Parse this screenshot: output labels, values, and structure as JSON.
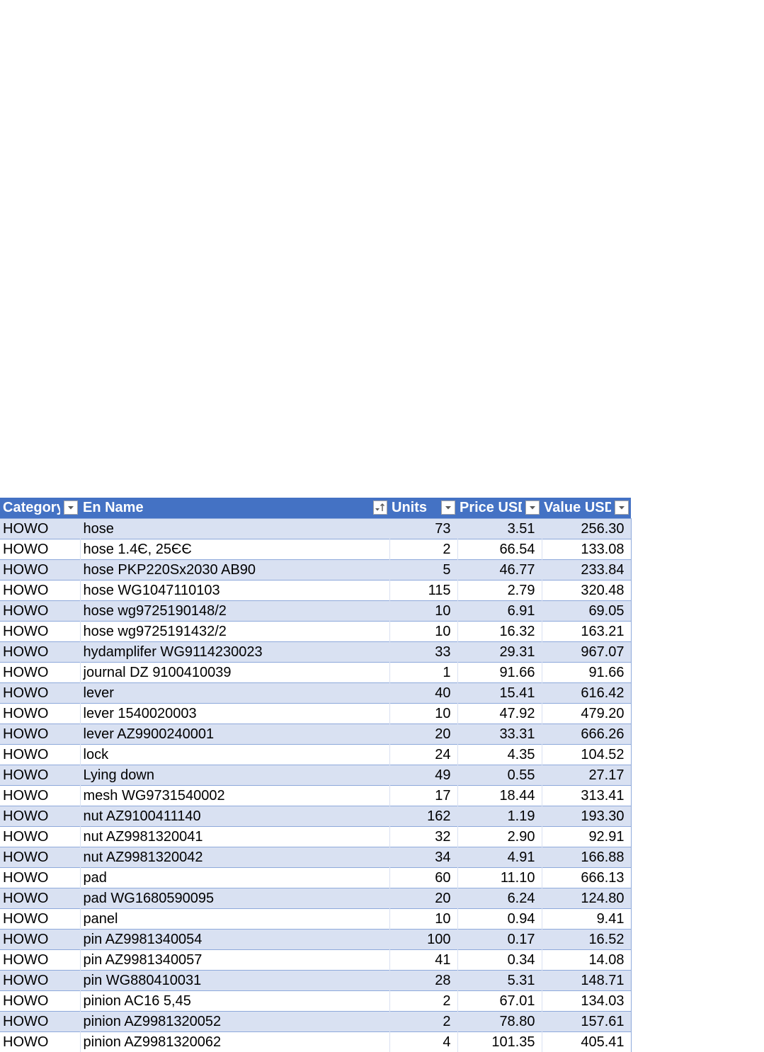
{
  "table": {
    "headers": {
      "category": "Category",
      "name": "En Name",
      "units": "Units",
      "price": "Price USD",
      "value": "Value USD"
    },
    "rows": [
      {
        "category": "HOWO",
        "name": "hose",
        "units": "73",
        "price": "3.51",
        "value": "256.30"
      },
      {
        "category": "HOWO",
        "name": "hose 1.4Є, 25ЄЄ",
        "units": "2",
        "price": "66.54",
        "value": "133.08"
      },
      {
        "category": "HOWO",
        "name": "hose PKP220Sx2030 AB90",
        "units": "5",
        "price": "46.77",
        "value": "233.84"
      },
      {
        "category": "HOWO",
        "name": "hose WG1047110103",
        "units": "115",
        "price": "2.79",
        "value": "320.48"
      },
      {
        "category": "HOWO",
        "name": "hose wg9725190148/2",
        "units": "10",
        "price": "6.91",
        "value": "69.05"
      },
      {
        "category": "HOWO",
        "name": "hose wg9725191432/2",
        "units": "10",
        "price": "16.32",
        "value": "163.21"
      },
      {
        "category": "HOWO",
        "name": "hydamplifer WG9114230023",
        "units": "33",
        "price": "29.31",
        "value": "967.07"
      },
      {
        "category": "HOWO",
        "name": "journal DZ 9100410039",
        "units": "1",
        "price": "91.66",
        "value": "91.66"
      },
      {
        "category": "HOWO",
        "name": "lever",
        "units": "40",
        "price": "15.41",
        "value": "616.42"
      },
      {
        "category": "HOWO",
        "name": "lever  1540020003",
        "units": "10",
        "price": "47.92",
        "value": "479.20"
      },
      {
        "category": "HOWO",
        "name": "lever AZ9900240001",
        "units": "20",
        "price": "33.31",
        "value": "666.26"
      },
      {
        "category": "HOWO",
        "name": "lock",
        "units": "24",
        "price": "4.35",
        "value": "104.52"
      },
      {
        "category": "HOWO",
        "name": "Lying down",
        "units": "49",
        "price": "0.55",
        "value": "27.17"
      },
      {
        "category": "HOWO",
        "name": "mesh WG9731540002",
        "units": "17",
        "price": "18.44",
        "value": "313.41"
      },
      {
        "category": "HOWO",
        "name": "nut AZ9100411140",
        "units": "162",
        "price": "1.19",
        "value": "193.30"
      },
      {
        "category": "HOWO",
        "name": "nut AZ9981320041",
        "units": "32",
        "price": "2.90",
        "value": "92.91"
      },
      {
        "category": "HOWO",
        "name": "nut AZ9981320042",
        "units": "34",
        "price": "4.91",
        "value": "166.88"
      },
      {
        "category": "HOWO",
        "name": "pad",
        "units": "60",
        "price": "11.10",
        "value": "666.13"
      },
      {
        "category": "HOWO",
        "name": "pad WG1680590095",
        "units": "20",
        "price": "6.24",
        "value": "124.80"
      },
      {
        "category": "HOWO",
        "name": "panel",
        "units": "10",
        "price": "0.94",
        "value": "9.41"
      },
      {
        "category": "HOWO",
        "name": "pin AZ9981340054",
        "units": "100",
        "price": "0.17",
        "value": "16.52"
      },
      {
        "category": "HOWO",
        "name": "pin AZ9981340057",
        "units": "41",
        "price": "0.34",
        "value": "14.08"
      },
      {
        "category": "HOWO",
        "name": "pin WG880410031",
        "units": "28",
        "price": "5.31",
        "value": "148.71"
      },
      {
        "category": "HOWO",
        "name": "pinion AC16 5,45",
        "units": "2",
        "price": "67.01",
        "value": "134.03"
      },
      {
        "category": "HOWO",
        "name": "pinion AZ9981320052",
        "units": "2",
        "price": "78.80",
        "value": "157.61"
      },
      {
        "category": "HOWO",
        "name": "pinion AZ9981320062",
        "units": "4",
        "price": "101.35",
        "value": "405.41"
      }
    ]
  },
  "icons": {
    "filter": "dropdown-arrow-icon",
    "sort": "sort-ascending-filter-icon"
  },
  "colors": {
    "header_bg": "#4472c4",
    "band": "#d9e1f2",
    "border": "#8ea9db"
  }
}
